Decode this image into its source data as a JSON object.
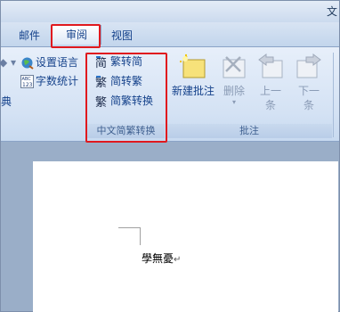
{
  "window": {
    "title_fragment": "文"
  },
  "tabs": [
    {
      "label": "邮件"
    },
    {
      "label": "审阅"
    },
    {
      "label": "视图"
    }
  ],
  "ribbon": {
    "left_partial_label": "典",
    "proofing": {
      "set_language": "设置语言",
      "word_count": "字数统计"
    },
    "chinese_conversion": {
      "group_label": "中文简繁转换",
      "trad_to_simp": "繁转简",
      "simp_to_trad": "简转繁",
      "convert": "简繁转换"
    },
    "comments": {
      "group_label": "批注",
      "new_comment": "新建批注",
      "delete": "删除",
      "previous": [
        "上一",
        "条"
      ],
      "next": [
        "下一",
        "条"
      ]
    }
  },
  "document": {
    "text": "學無憂",
    "paragraph_mark": "↵"
  }
}
